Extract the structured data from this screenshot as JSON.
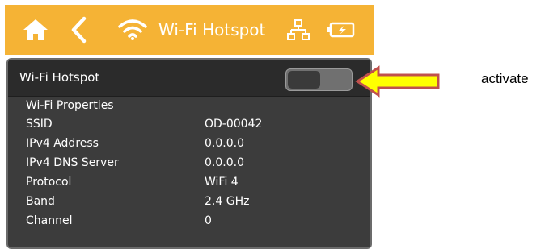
{
  "header": {
    "title": "Wi-Fi Hotspot",
    "icons": [
      "home-icon",
      "back-chevron-icon",
      "wifi-icon",
      "network-icon",
      "battery-icon"
    ]
  },
  "hotspot": {
    "label": "Wi-Fi Hotspot",
    "toggle_state": "off"
  },
  "properties": {
    "title": "Wi-Fi Properties",
    "rows": [
      {
        "label": "SSID",
        "value": "OD-00042"
      },
      {
        "label": "IPv4 Address",
        "value": "0.0.0.0"
      },
      {
        "label": "IPv4 DNS Server",
        "value": "0.0.0.0"
      },
      {
        "label": "Protocol",
        "value": "WiFi 4"
      },
      {
        "label": "Band",
        "value": "2.4 GHz"
      },
      {
        "label": "Channel",
        "value": "0"
      }
    ]
  },
  "annotation": {
    "text": "activate"
  },
  "colors": {
    "header": "#f5b335",
    "screen": "#3c3c3c",
    "arrow_fill": "#ffff00",
    "arrow_stroke": "#c0504d"
  }
}
